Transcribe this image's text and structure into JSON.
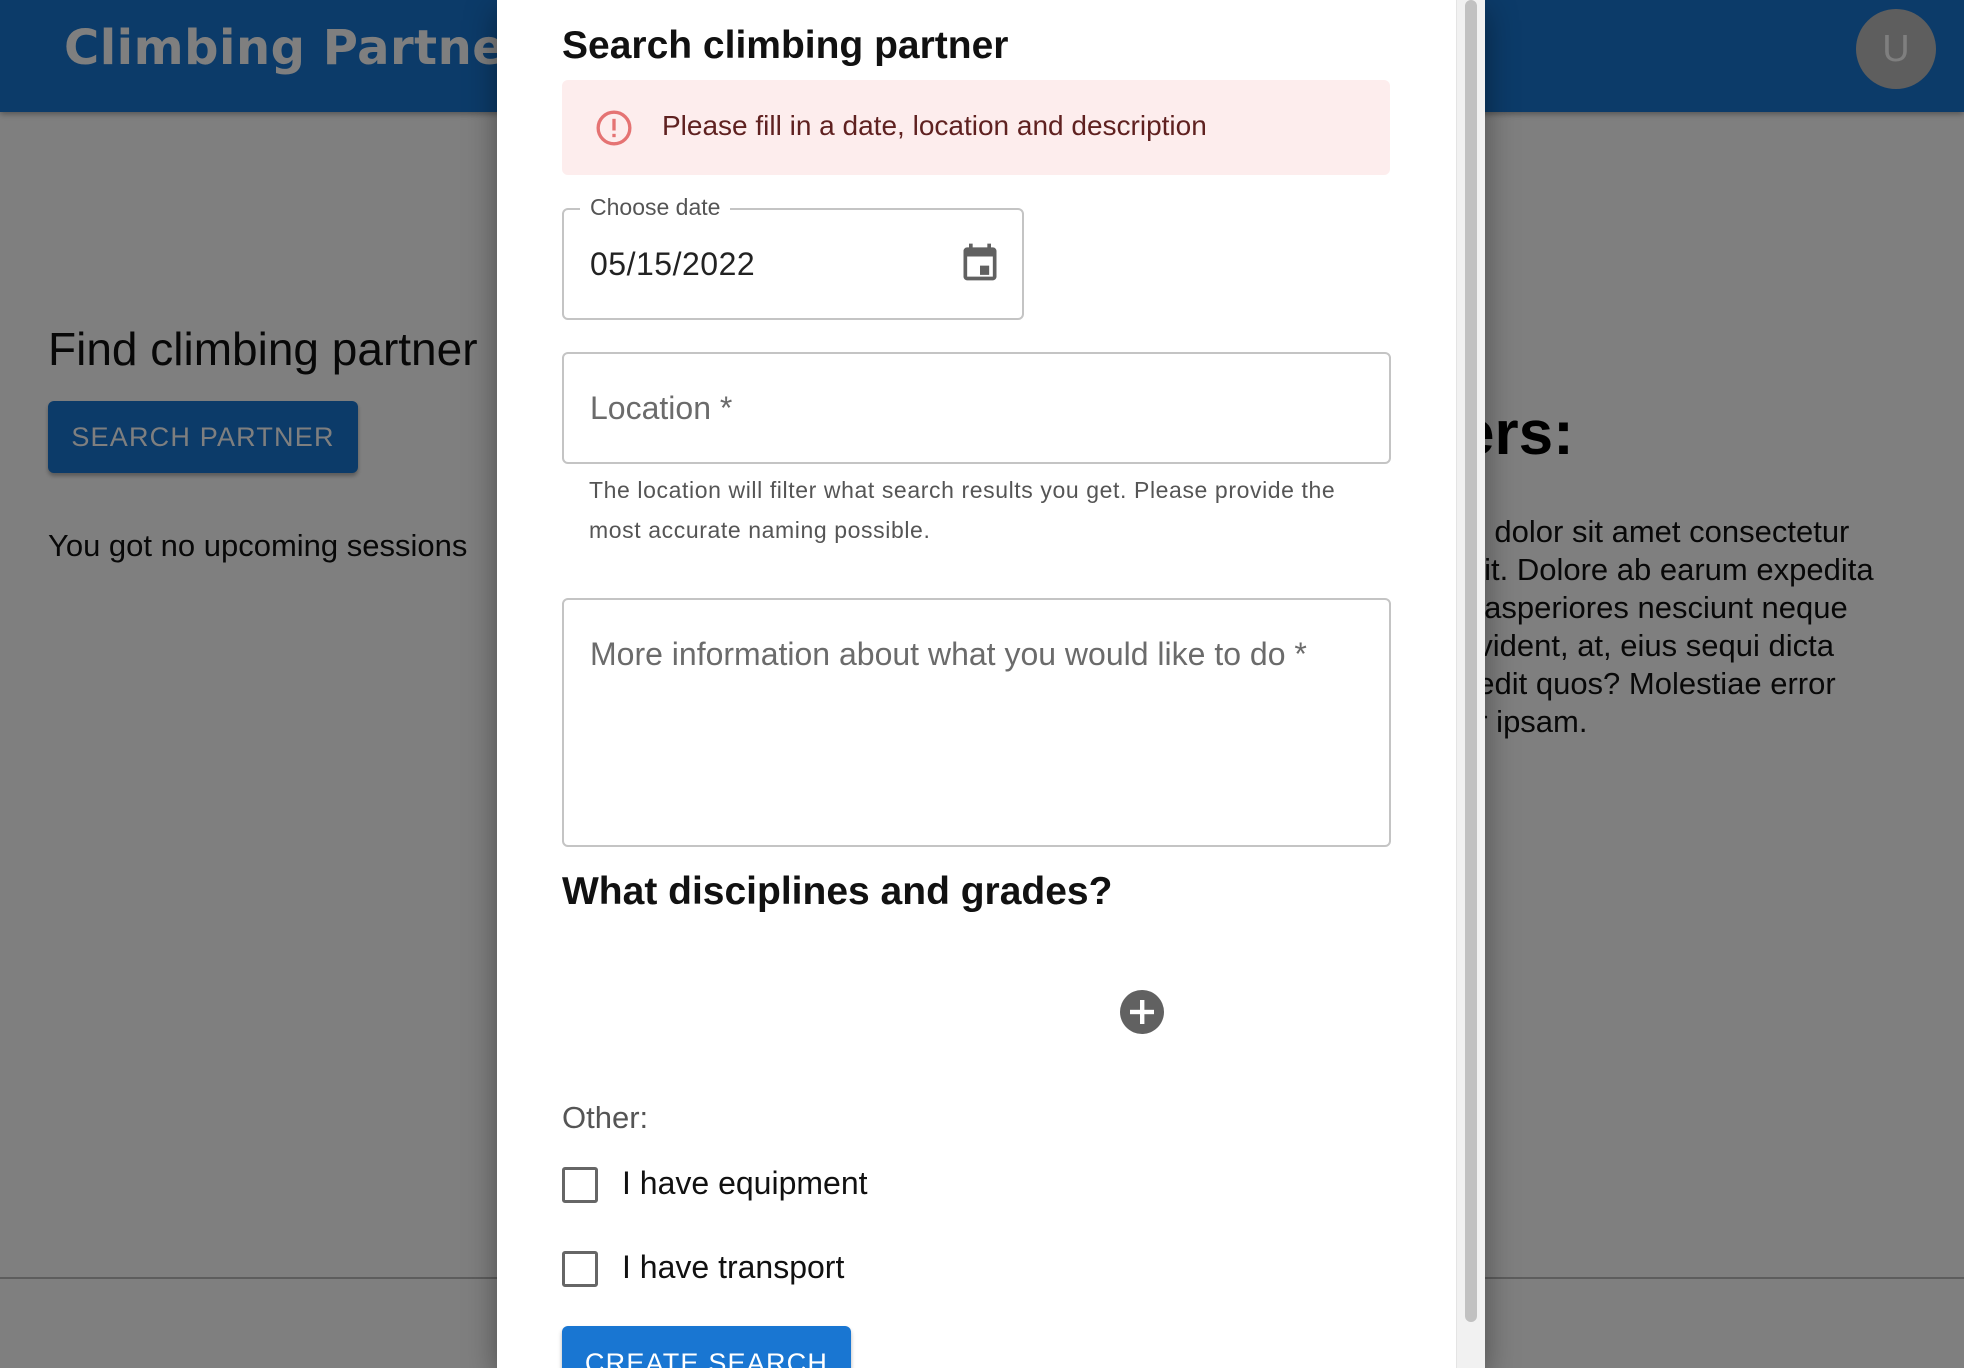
{
  "app": {
    "brand": "Climbing Partners",
    "avatar_initial": "U",
    "brand_color": "#1976d2"
  },
  "background": {
    "find_title": "Find climbing partner",
    "search_button": "SEARCH PARTNER",
    "no_sessions": "You got no upcoming sessions",
    "right_heading": "ers:",
    "right_lines": [
      "m dolor sit amet consectetur",
      "elit. Dolore ab earum expedita",
      "s asperiores nesciunt neque",
      "ovident, at, eius sequi dicta",
      "pedit quos? Molestiae error",
      "ur ipsam."
    ]
  },
  "dialog": {
    "title": "Search climbing partner",
    "alert": {
      "text": "Please fill in a date, location and description",
      "icon": "error-outline-icon",
      "bg_color": "#fdeded",
      "icon_color": "#d32f2f"
    },
    "date": {
      "label": "Choose date",
      "value": "05/15/2022",
      "icon": "calendar-icon"
    },
    "location": {
      "placeholder": "Location *",
      "helper": "The location will filter what search results you get. Please provide the most accurate naming possible."
    },
    "description": {
      "placeholder": "More information about what you would like to do *"
    },
    "disciplines_heading": "What disciplines and grades?",
    "add_icon": "add-circle-icon",
    "other_label": "Other:",
    "checkboxes": [
      {
        "label": "I have equipment",
        "checked": false
      },
      {
        "label": "I have transport",
        "checked": false
      }
    ],
    "submit_label": "CREATE SEARCH"
  }
}
